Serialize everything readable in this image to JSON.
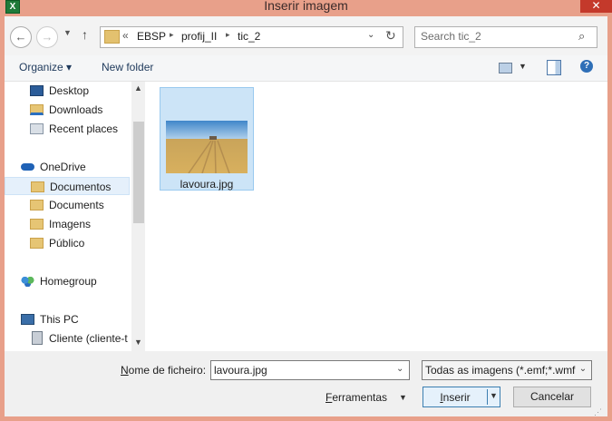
{
  "window": {
    "title": "Inserir imagem",
    "close_symbol": "✕",
    "app_icon_letter": "X"
  },
  "nav_buttons": {
    "back": "←",
    "forward": "→",
    "recent": "▼",
    "up": "↑"
  },
  "address": {
    "prefix": "«",
    "crumbs": [
      "EBSP",
      "profij_II",
      "tic_2"
    ],
    "separator": "▸",
    "dropdown": "⌄",
    "refresh": "↻"
  },
  "search": {
    "placeholder": "Search tic_2",
    "icon": "⌕"
  },
  "toolbar": {
    "organize_label": "Organize ▾",
    "new_folder_label": "New folder",
    "view_drop": "▼",
    "help": "?"
  },
  "sidebar": {
    "items": [
      {
        "label": "Desktop",
        "icon": "desktop-icon"
      },
      {
        "label": "Downloads",
        "icon": "downloads-folder-icon"
      },
      {
        "label": "Recent places",
        "icon": "recent-places-icon"
      },
      {
        "label": "OneDrive",
        "icon": "onedrive-icon"
      },
      {
        "label": "Documentos",
        "icon": "folder-icon",
        "selected": true
      },
      {
        "label": "Documents",
        "icon": "folder-icon"
      },
      {
        "label": "Imagens",
        "icon": "folder-icon"
      },
      {
        "label": "Público",
        "icon": "folder-icon"
      },
      {
        "label": "Homegroup",
        "icon": "homegroup-icon"
      },
      {
        "label": "This PC",
        "icon": "computer-icon"
      },
      {
        "label": "Cliente (cliente-t",
        "icon": "network-drive-icon"
      }
    ],
    "scroll_up": "▲",
    "scroll_down": "▼"
  },
  "files": [
    {
      "name": "lavoura.jpg",
      "type": "image-thumbnail",
      "selected": true
    }
  ],
  "footer": {
    "filename_label_mnemonic": "N",
    "filename_label_rest": "ome de ficheiro:",
    "filename_value": "lavoura.jpg",
    "filter_value": "Todas as imagens (*.emf;*.wmf",
    "tools_mnemonic": "F",
    "tools_rest": "erramentas",
    "tools_drop": "▼",
    "insert_mnemonic": "I",
    "insert_rest": "nserir",
    "cancel_label": "Cancelar",
    "dropdown_symbol": "⌄"
  }
}
